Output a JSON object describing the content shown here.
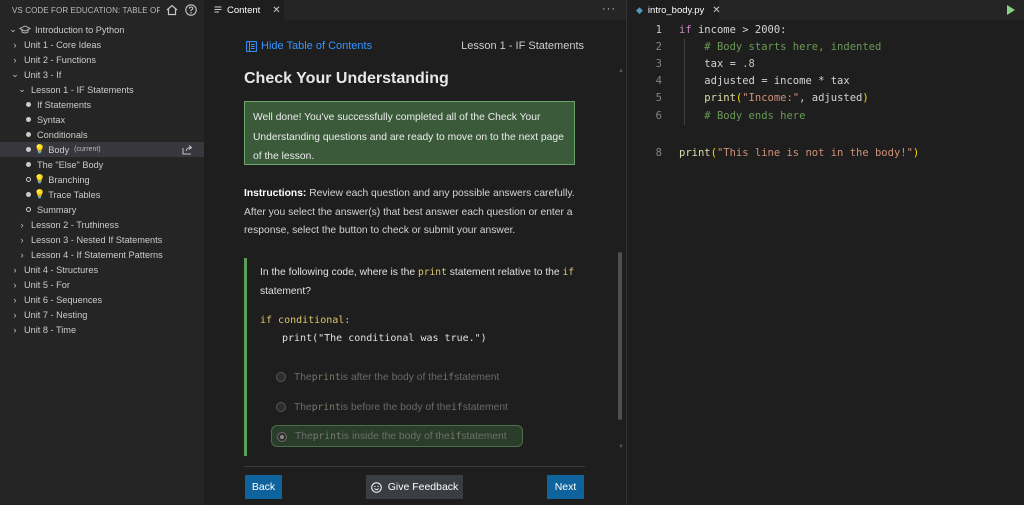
{
  "sidebar": {
    "title": "VS CODE FOR EDUCATION: TABLE OF CON...",
    "tree": [
      {
        "label": "Introduction to Python",
        "kind": "root",
        "indent": 0
      },
      {
        "label": "Unit 1 - Core Ideas",
        "kind": "collapsed",
        "indent": 1
      },
      {
        "label": "Unit 2 - Functions",
        "kind": "collapsed",
        "indent": 1
      },
      {
        "label": "Unit 3 - If",
        "kind": "expanded",
        "indent": 1
      },
      {
        "label": "Lesson 1 - IF Statements",
        "kind": "expanded",
        "indent": 2
      },
      {
        "label": "If Statements",
        "kind": "done",
        "indent": 3
      },
      {
        "label": "Syntax",
        "kind": "done",
        "indent": 3
      },
      {
        "label": "Conditionals",
        "kind": "done",
        "indent": 3
      },
      {
        "label": "Body",
        "kind": "done-bulb",
        "indent": 3,
        "tag": "(current)",
        "selected": true
      },
      {
        "label": "The \"Else\" Body",
        "kind": "done",
        "indent": 3
      },
      {
        "label": "Branching",
        "kind": "open-bulb",
        "indent": 3
      },
      {
        "label": "Trace Tables",
        "kind": "done-bulb",
        "indent": 3
      },
      {
        "label": "Summary",
        "kind": "open",
        "indent": 3
      },
      {
        "label": "Lesson 2 - Truthiness",
        "kind": "collapsed",
        "indent": 2
      },
      {
        "label": "Lesson 3 - Nested If Statements",
        "kind": "collapsed",
        "indent": 2
      },
      {
        "label": "Lesson 4 - If Statement Patterns",
        "kind": "collapsed",
        "indent": 2
      },
      {
        "label": "Unit 4 - Structures",
        "kind": "collapsed",
        "indent": 1
      },
      {
        "label": "Unit 5 - For",
        "kind": "collapsed",
        "indent": 1
      },
      {
        "label": "Unit 6 - Sequences",
        "kind": "collapsed",
        "indent": 1
      },
      {
        "label": "Unit 7 - Nesting",
        "kind": "collapsed",
        "indent": 1
      },
      {
        "label": "Unit 8 - Time",
        "kind": "collapsed",
        "indent": 1
      }
    ]
  },
  "content": {
    "tab_label": "Content",
    "toc_link": "Hide Table of Contents",
    "lesson_label": "Lesson 1 - IF Statements",
    "title": "Check Your Understanding",
    "success_message": "Well done! You've successfully completed all of the Check Your Understanding questions and are ready to move on to the next page of the lesson.",
    "instructions_label": "Instructions:",
    "instructions_text": " Review each question and any possible answers carefully. After you select the answer(s) that best answer each question or enter a response, select the button to check or submit your answer.",
    "question": {
      "prefix": "In the following code, where is the ",
      "kw1": "print",
      "middle": " statement relative to the ",
      "kw2": "if",
      "suffix": " statement?",
      "code_line_1": "if conditional:",
      "code_line_2": "print(\"The conditional was true.\")",
      "options": [
        {
          "pre": "The ",
          "kw1": "print",
          "mid": " is after the body of the ",
          "kw2": "if",
          "post": " statement",
          "selected": false
        },
        {
          "pre": "The ",
          "kw1": "print",
          "mid": " is before the body of the ",
          "kw2": "if",
          "post": " statement",
          "selected": false
        },
        {
          "pre": "The ",
          "kw1": "print",
          "mid": " is inside the body of the ",
          "kw2": "if",
          "post": " statement",
          "selected": true
        }
      ]
    },
    "back_label": "Back",
    "feedback_label": "Give Feedback",
    "next_label": "Next"
  },
  "editor": {
    "tab_label": "intro_body.py",
    "lines": [
      {
        "n": "1",
        "active": true
      },
      {
        "n": "2"
      },
      {
        "n": "3"
      },
      {
        "n": "4"
      },
      {
        "n": "5"
      },
      {
        "n": "6"
      },
      {
        "n": "8"
      }
    ],
    "tokens": {
      "l1_kw": "if",
      "l1_rest": " income > 2000:",
      "l2": "# Body starts here, indented",
      "l3_a": "tax = ",
      "l3_num": ".8",
      "l4": "adjusted = income * tax",
      "l5_fn": "print",
      "l5_str": "\"Income:\"",
      "l5_rest": ", adjusted",
      "l6": "# Body ends here",
      "l8_fn": "print",
      "l8_str": "\"This line is not in the body!\""
    }
  }
}
